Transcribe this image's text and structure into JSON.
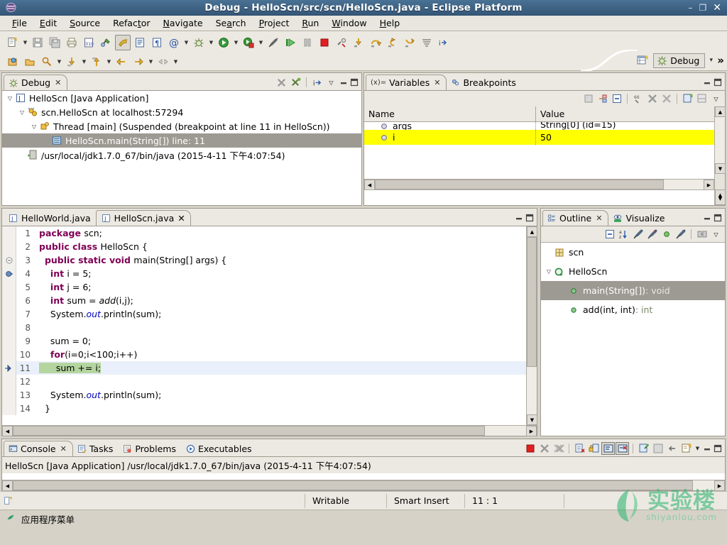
{
  "window": {
    "title": "Debug - HelloScn/src/scn/HelloScn.java - Eclipse Platform",
    "app_icon": "eclipse-icon",
    "minimize": "–",
    "maximize": "❐",
    "close": "✕",
    "titlebar_color": "#3f6384"
  },
  "menubar": {
    "items": [
      {
        "label": "File",
        "mnemonic": "F"
      },
      {
        "label": "Edit",
        "mnemonic": "E"
      },
      {
        "label": "Source",
        "mnemonic": "S"
      },
      {
        "label": "Refactor",
        "mnemonic": "t"
      },
      {
        "label": "Navigate",
        "mnemonic": "N"
      },
      {
        "label": "Search",
        "mnemonic": "a"
      },
      {
        "label": "Project",
        "mnemonic": "P"
      },
      {
        "label": "Run",
        "mnemonic": "R"
      },
      {
        "label": "Window",
        "mnemonic": "W"
      },
      {
        "label": "Help",
        "mnemonic": "H"
      }
    ]
  },
  "toolbar": {
    "row1": [
      {
        "name": "new-wizard-button",
        "icon": "new-file-icon",
        "dropdown": true
      },
      {
        "name": "save-button",
        "icon": "save-icon"
      },
      {
        "name": "save-all-button",
        "icon": "save-all-icon"
      },
      {
        "name": "print-button",
        "icon": "print-icon"
      },
      {
        "name": "toggle-hex-button",
        "icon": "hex-010-icon"
      },
      {
        "name": "build-button",
        "icon": "build-icon"
      },
      {
        "name": "skip-breakpoints-button",
        "icon": "skip-breakpoints-icon",
        "pressed": true
      },
      {
        "name": "open-type-button",
        "icon": "open-type-icon"
      },
      {
        "name": "open-task-button",
        "icon": "paragraph-icon"
      },
      {
        "name": "annotation-button",
        "icon": "at-sign-icon",
        "dropdown": true
      },
      {
        "name": "debug-button",
        "icon": "debug-bug-icon",
        "dropdown": true
      },
      {
        "name": "run-button",
        "icon": "run-play-icon",
        "dropdown": true
      },
      {
        "name": "external-tools-button",
        "icon": "external-tools-icon",
        "dropdown": true
      },
      {
        "name": "toggle-markers-button",
        "icon": "pencil-strike-icon"
      },
      {
        "name": "resume-button",
        "icon": "resume-icon"
      },
      {
        "name": "suspend-button",
        "icon": "suspend-icon"
      },
      {
        "name": "terminate-button",
        "icon": "terminate-stop-icon"
      },
      {
        "name": "disconnect-button",
        "icon": "disconnect-icon"
      },
      {
        "name": "step-into-button",
        "icon": "step-into-icon"
      },
      {
        "name": "step-over-button",
        "icon": "step-over-icon"
      },
      {
        "name": "step-return-button",
        "icon": "step-return-icon"
      },
      {
        "name": "drop-to-frame-button",
        "icon": "drop-to-frame-icon"
      },
      {
        "name": "use-step-filters-button",
        "icon": "step-filters-icon"
      },
      {
        "name": "instruction-stepping-button",
        "icon": "instruction-step-icon"
      }
    ],
    "row2": [
      {
        "name": "new-java-project-button",
        "icon": "java-project-icon"
      },
      {
        "name": "open-resource-button",
        "icon": "open-folder-icon"
      },
      {
        "name": "search-button",
        "icon": "search-pin-icon",
        "dropdown": true
      },
      {
        "name": "next-annotation-button",
        "icon": "next-annotation-icon",
        "dropdown": true
      },
      {
        "name": "previous-annotation-button",
        "icon": "previous-annotation-icon",
        "dropdown": true
      },
      {
        "name": "back-history-button",
        "icon": "back-arrow-icon"
      },
      {
        "name": "forward-history-button",
        "icon": "forward-arrow-icon",
        "dropdown": true
      },
      {
        "name": "last-edit-location-button",
        "icon": "last-edit-icon",
        "dropdown": true
      }
    ],
    "perspective": {
      "open_perspective_icon": "open-perspective-icon",
      "current_label": "Debug",
      "current_icon": "debug-perspective-icon",
      "chevron": "▾",
      "overflow": "»"
    }
  },
  "debug_view": {
    "tabs": [
      {
        "label": "Debug",
        "icon": "debug-perspective-icon",
        "active": true,
        "closable": true
      }
    ],
    "toolbar": [
      {
        "name": "remove-all-terminated-button",
        "icon": "remove-all-terminated-icon"
      },
      {
        "name": "relaunch-button",
        "icon": "relaunch-icon"
      },
      {
        "name": "show-debug-toolbar-button",
        "icon": "debug-toolbar-icon"
      }
    ],
    "menu_icon": "view-menu-icon",
    "minimize_icon": "minimize-icon",
    "maximize_icon": "maximize-icon",
    "tree": [
      {
        "indent": 0,
        "twist": "▽",
        "icon": "java-launch-icon",
        "label": "HelloScn [Java Application]",
        "selected": false
      },
      {
        "indent": 1,
        "twist": "▽",
        "icon": "debug-target-icon",
        "label": "scn.HelloScn at localhost:57294",
        "selected": false
      },
      {
        "indent": 2,
        "twist": "▽",
        "icon": "thread-icon",
        "label": "Thread [main] (Suspended (breakpoint at line 11 in HelloScn))",
        "selected": false
      },
      {
        "indent": 3,
        "twist": "",
        "icon": "stack-frame-icon",
        "label": "HelloScn.main(String[]) line: 11",
        "selected": true
      },
      {
        "indent": 1,
        "twist": "",
        "icon": "process-icon",
        "label": "/usr/local/jdk1.7.0_67/bin/java (2015-4-11 下午4:07:54)",
        "selected": false
      }
    ]
  },
  "variables_view": {
    "tabs": [
      {
        "label": "Variables",
        "icon": "variables-icon",
        "active": true,
        "closable": true
      },
      {
        "label": "Breakpoints",
        "icon": "breakpoints-icon",
        "active": false,
        "closable": false
      }
    ],
    "toolbar": [
      {
        "name": "show-type-names-button",
        "icon": "type-names-icon"
      },
      {
        "name": "show-logical-structure-button",
        "icon": "logical-structure-icon"
      },
      {
        "name": "collapse-all-button",
        "icon": "collapse-all-icon"
      },
      {
        "name": "sixty-six-button",
        "icon": "watch-expression-icon"
      },
      {
        "name": "remove-all-button",
        "icon": "remove-all-icon"
      },
      {
        "name": "remove-selected-button",
        "icon": "remove-selected-icon"
      },
      {
        "name": "new-detail-pane-button",
        "icon": "new-detail-icon"
      },
      {
        "name": "detail-pane-button",
        "icon": "detail-pane-icon"
      }
    ],
    "menu_icon": "view-menu-icon",
    "minimize_icon": "minimize-icon",
    "maximize_icon": "maximize-icon",
    "columns": [
      "Name",
      "Value"
    ],
    "rows": [
      {
        "name": "args",
        "value": "String[0] (id=15)",
        "icon": "variable-icon",
        "highlighted": false,
        "partial": true
      },
      {
        "name": "i",
        "value": "50",
        "icon": "variable-icon",
        "highlighted": true,
        "partial": false
      }
    ],
    "highlight_color": "#ffff00"
  },
  "editor": {
    "tabs": [
      {
        "label": "HelloWorld.java",
        "icon": "java-file-icon",
        "active": false,
        "closable": false
      },
      {
        "label": "HelloScn.java",
        "icon": "java-file-icon",
        "active": true,
        "closable": true
      }
    ],
    "minimize_icon": "minimize-icon",
    "maximize_icon": "maximize-icon",
    "current_line": 11,
    "lines": [
      {
        "n": "1",
        "marker": "",
        "tokens": [
          {
            "t": "package ",
            "c": "kw"
          },
          {
            "t": "scn;",
            "c": ""
          }
        ],
        "hl": ""
      },
      {
        "n": "2",
        "marker": "",
        "tokens": [
          {
            "t": "public class ",
            "c": "kw"
          },
          {
            "t": "HelloScn {",
            "c": ""
          }
        ],
        "hl": ""
      },
      {
        "n": "3",
        "marker": "fold",
        "tokens": [
          {
            "t": "  ",
            "c": ""
          },
          {
            "t": "public static void ",
            "c": "kw"
          },
          {
            "t": "main(String[] args) {",
            "c": ""
          }
        ],
        "hl": ""
      },
      {
        "n": "4",
        "marker": "breakpoint-passed",
        "tokens": [
          {
            "t": "    ",
            "c": ""
          },
          {
            "t": "int ",
            "c": "kw"
          },
          {
            "t": "i = 5;",
            "c": ""
          }
        ],
        "hl": ""
      },
      {
        "n": "5",
        "marker": "",
        "tokens": [
          {
            "t": "    ",
            "c": ""
          },
          {
            "t": "int ",
            "c": "kw"
          },
          {
            "t": "j = 6;",
            "c": ""
          }
        ],
        "hl": ""
      },
      {
        "n": "6",
        "marker": "",
        "tokens": [
          {
            "t": "    ",
            "c": ""
          },
          {
            "t": "int ",
            "c": "kw"
          },
          {
            "t": "sum = ",
            "c": ""
          },
          {
            "t": "add",
            "c": "mth"
          },
          {
            "t": "(i,j);",
            "c": ""
          }
        ],
        "hl": ""
      },
      {
        "n": "7",
        "marker": "",
        "tokens": [
          {
            "t": "    System.",
            "c": ""
          },
          {
            "t": "out",
            "c": "fld"
          },
          {
            "t": ".println(sum);",
            "c": ""
          }
        ],
        "hl": ""
      },
      {
        "n": "8",
        "marker": "",
        "tokens": [
          {
            "t": "",
            "c": ""
          }
        ],
        "hl": ""
      },
      {
        "n": "9",
        "marker": "",
        "tokens": [
          {
            "t": "    sum = 0;",
            "c": ""
          }
        ],
        "hl": ""
      },
      {
        "n": "10",
        "marker": "",
        "tokens": [
          {
            "t": "    ",
            "c": ""
          },
          {
            "t": "for",
            "c": "kw"
          },
          {
            "t": "(i=0;i<100;i++)",
            "c": ""
          }
        ],
        "hl": ""
      },
      {
        "n": "11",
        "marker": "current-instruction",
        "tokens": [
          {
            "t": "      sum += i;",
            "c": ""
          }
        ],
        "hl": "current"
      },
      {
        "n": "12",
        "marker": "",
        "tokens": [
          {
            "t": "",
            "c": ""
          }
        ],
        "hl": ""
      },
      {
        "n": "13",
        "marker": "",
        "tokens": [
          {
            "t": "    System.",
            "c": ""
          },
          {
            "t": "out",
            "c": "fld"
          },
          {
            "t": ".println(sum);",
            "c": ""
          }
        ],
        "hl": ""
      },
      {
        "n": "14",
        "marker": "",
        "tokens": [
          {
            "t": "  }",
            "c": ""
          }
        ],
        "hl": ""
      }
    ]
  },
  "outline_view": {
    "tabs": [
      {
        "label": "Outline",
        "icon": "outline-icon",
        "active": true,
        "closable": true
      },
      {
        "label": "Visualize",
        "icon": "visualize-icon",
        "active": false,
        "closable": false
      }
    ],
    "toolbar": [
      {
        "name": "collapse-all-button",
        "icon": "collapse-all-icon"
      },
      {
        "name": "sort-button",
        "icon": "sort-az-icon"
      },
      {
        "name": "hide-fields-button",
        "icon": "hide-fields-icon"
      },
      {
        "name": "hide-static-button",
        "icon": "hide-static-icon"
      },
      {
        "name": "hide-nonpublic-button",
        "icon": "hide-nonpublic-icon"
      },
      {
        "name": "hide-local-types-button",
        "icon": "hide-local-types-icon"
      },
      {
        "name": "link-editor-button",
        "icon": "link-editor-icon"
      }
    ],
    "menu_icon": "view-menu-icon",
    "minimize_icon": "minimize-icon",
    "maximize_icon": "maximize-icon",
    "tree": [
      {
        "indent": 0,
        "twist": "",
        "icon": "package-icon",
        "label": "scn",
        "suffix": "",
        "selected": false
      },
      {
        "indent": 0,
        "twist": "▽",
        "icon": "class-icon",
        "label": "HelloScn",
        "suffix": "",
        "selected": false
      },
      {
        "indent": 1,
        "twist": "",
        "icon": "method-static-icon",
        "label": "main(String[])",
        "suffix": " : void",
        "selected": true
      },
      {
        "indent": 1,
        "twist": "",
        "icon": "method-static-icon",
        "label": "add(int, int)",
        "suffix": " : int",
        "selected": false
      }
    ]
  },
  "console_view": {
    "tabs": [
      {
        "label": "Console",
        "icon": "console-icon",
        "active": true,
        "closable": true
      },
      {
        "label": "Tasks",
        "icon": "tasks-icon",
        "active": false,
        "closable": false
      },
      {
        "label": "Problems",
        "icon": "problems-icon",
        "active": false,
        "closable": false
      },
      {
        "label": "Executables",
        "icon": "executables-icon",
        "active": false,
        "closable": false
      }
    ],
    "toolbar": [
      {
        "name": "terminate-button",
        "icon": "terminate-stop-icon"
      },
      {
        "name": "remove-launch-button",
        "icon": "remove-launch-icon"
      },
      {
        "name": "remove-all-launches-button",
        "icon": "remove-all-launches-icon"
      },
      {
        "name": "clear-console-button",
        "icon": "clear-console-icon"
      },
      {
        "name": "scroll-lock-button",
        "icon": "scroll-lock-icon"
      },
      {
        "name": "show-console-on-output-button",
        "icon": "show-console-out-icon",
        "pressed": true
      },
      {
        "name": "show-console-on-error-button",
        "icon": "show-console-err-icon",
        "pressed": true
      },
      {
        "name": "pin-console-button",
        "icon": "pin-console-icon"
      },
      {
        "name": "display-selected-console-button",
        "icon": "display-console-icon"
      },
      {
        "name": "previous-console-button",
        "icon": "previous-console-icon"
      },
      {
        "name": "open-console-button",
        "icon": "open-console-icon",
        "dropdown": true
      }
    ],
    "minimize_icon": "minimize-icon",
    "maximize_icon": "maximize-icon",
    "header_text": "HelloScn [Java Application] /usr/local/jdk1.7.0_67/bin/java (2015-4-11 下午4:07:54)",
    "body_text": ""
  },
  "statusbar": {
    "left_icon": "editor-status-icon",
    "cells": [
      {
        "name": "writable-status",
        "label": "Writable"
      },
      {
        "name": "insert-mode-status",
        "label": "Smart Insert"
      },
      {
        "name": "cursor-position-status",
        "label": "11 : 1"
      }
    ]
  },
  "taskbar": {
    "icon": "applications-menu-icon",
    "label": "应用程序菜单"
  },
  "watermark": {
    "logo_icon": "shiyanlou-leaf-icon",
    "cn": "实验楼",
    "en": "shiyanlou.com",
    "color": "#3cb878"
  }
}
